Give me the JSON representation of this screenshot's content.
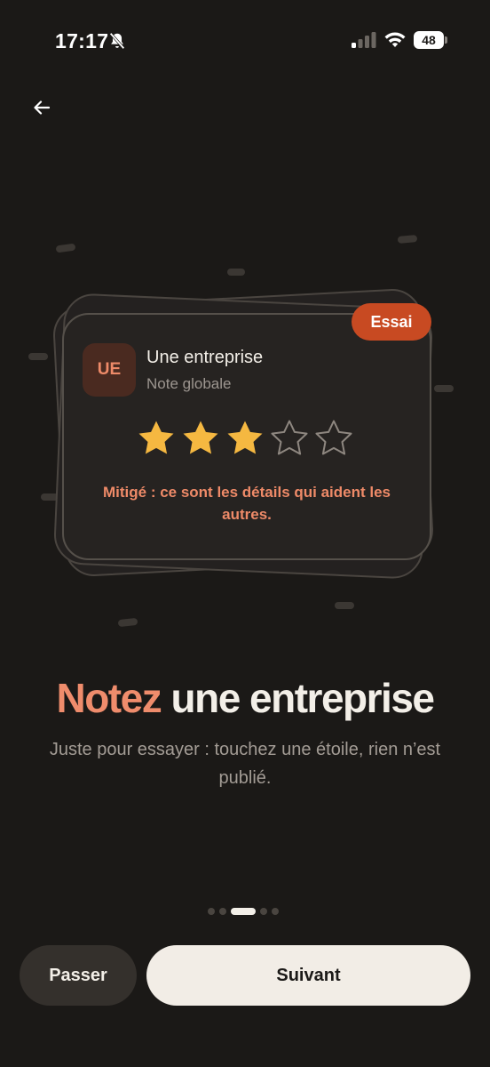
{
  "status_bar": {
    "time": "17:17",
    "battery": "48",
    "icons": [
      "bell-slash-icon",
      "signal-icon",
      "wifi-icon",
      "battery-icon"
    ]
  },
  "nav": {
    "back_icon": "arrow-left-icon"
  },
  "card": {
    "badge": "Essai",
    "avatar_initials": "UE",
    "company_name": "Une entreprise",
    "company_subtitle": "Note globale",
    "rating": 3,
    "rating_max": 5,
    "hint": "Mitigé : ce sont les détails qui aident les autres."
  },
  "headline": {
    "accent": "Notez",
    "rest": " une entreprise"
  },
  "subtitle": "Juste pour essayer : touchez une étoile, rien n’est publié.",
  "pager": {
    "count": 5,
    "active_index": 2
  },
  "buttons": {
    "skip": "Passer",
    "next": "Suivant"
  },
  "colors": {
    "background": "#1b1917",
    "accent": "#ef8c6c",
    "badge": "#c84a22",
    "star_filled": "#f5b841",
    "star_empty": "#8e8780"
  }
}
